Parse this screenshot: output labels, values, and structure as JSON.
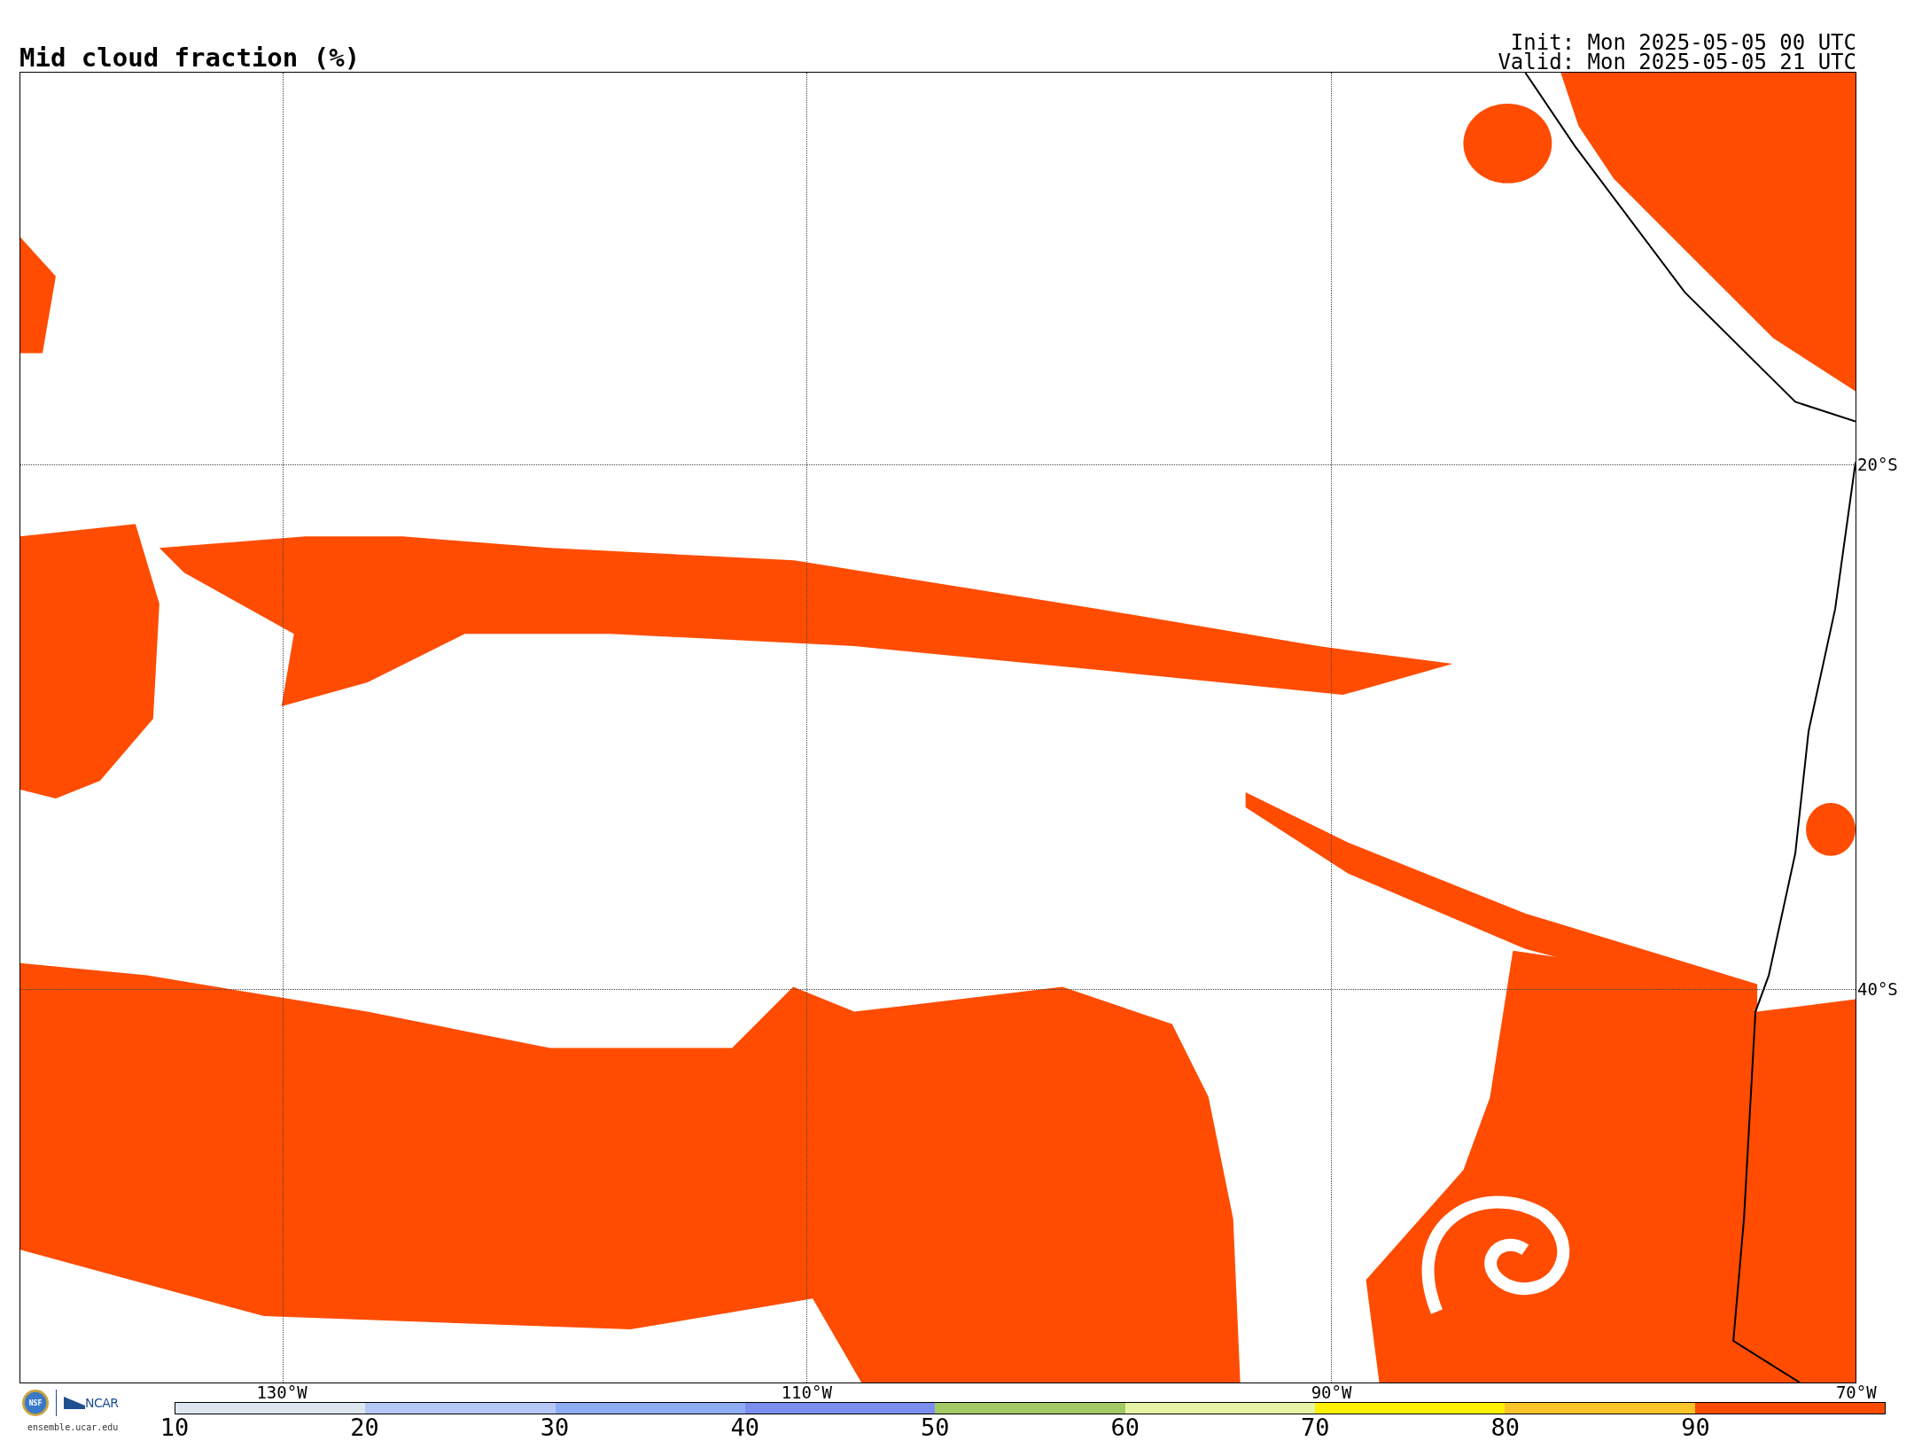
{
  "title": "Mid cloud fraction (%)",
  "run": {
    "init": "Init: Mon 2025-05-05 00 UTC",
    "valid": "Valid: Mon 2025-05-05 21 UTC"
  },
  "map": {
    "lat_labels": [
      "20°S",
      "40°S"
    ],
    "lon_labels": [
      "130°W",
      "110°W",
      "90°W",
      "70°W"
    ]
  },
  "logos": {
    "nsf": "NSF",
    "ncar": "NCAR",
    "site": "ensemble.ucar.edu"
  },
  "colorbar": {
    "segments": [
      {
        "color": "#dde6ee"
      },
      {
        "color": "#b5c8f5"
      },
      {
        "color": "#8fadf5"
      },
      {
        "color": "#7b8ef0"
      },
      {
        "color": "#a5c964"
      },
      {
        "color": "#e6f5a5"
      },
      {
        "color": "#fff200"
      },
      {
        "color": "#fcc52a"
      },
      {
        "color": "#ff4c00"
      }
    ],
    "ticks": [
      "10",
      "20",
      "30",
      "40",
      "50",
      "60",
      "70",
      "80",
      "90"
    ]
  }
}
